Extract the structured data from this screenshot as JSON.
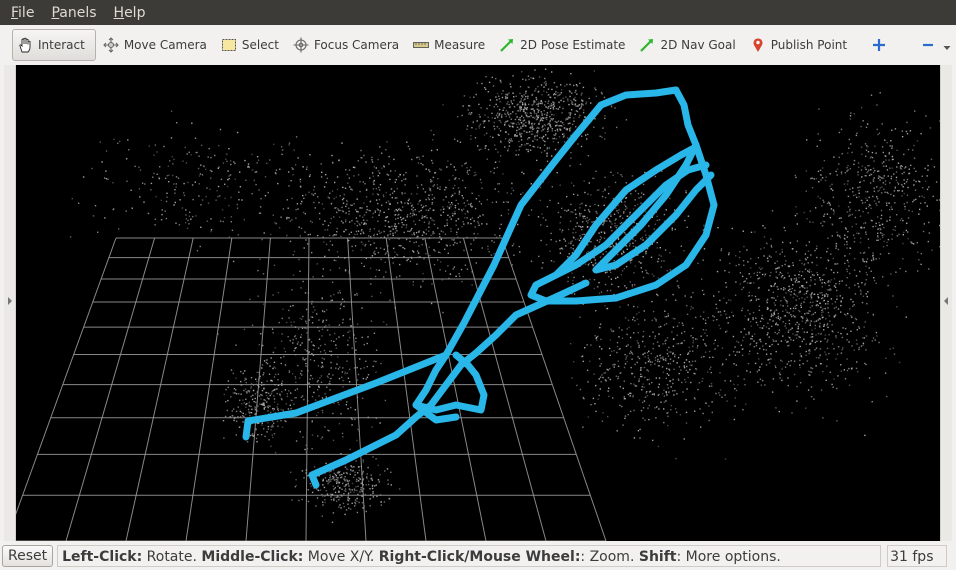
{
  "menubar": {
    "items": [
      {
        "mnemonic": "F",
        "rest": "ile"
      },
      {
        "mnemonic": "P",
        "rest": "anels"
      },
      {
        "mnemonic": "H",
        "rest": "elp"
      }
    ]
  },
  "toolbar": {
    "tools": [
      {
        "label": "Interact",
        "icon": "hand-icon",
        "active": true
      },
      {
        "label": "Move Camera",
        "icon": "move-camera-icon"
      },
      {
        "label": "Select",
        "icon": "select-icon"
      },
      {
        "label": "Focus Camera",
        "icon": "focus-camera-icon"
      },
      {
        "label": "Measure",
        "icon": "ruler-icon"
      },
      {
        "label": "2D Pose Estimate",
        "icon": "green-arrow-icon"
      },
      {
        "label": "2D Nav Goal",
        "icon": "green-arrow-icon"
      },
      {
        "label": "Publish Point",
        "icon": "map-pin-icon"
      }
    ],
    "add_icon": "plus-icon",
    "remove_icon": "minus-icon",
    "dropdown_icon": "chevron-down-icon"
  },
  "viewport": {
    "background": "#000000",
    "grid_color": "#a0a0a0",
    "point_color": "#b4b4b4",
    "path_color": "#29b6e8"
  },
  "statusbar": {
    "reset_label": "Reset",
    "help": {
      "left_click_key": "Left-Click:",
      "left_click_action": " Rotate. ",
      "middle_click_key": "Middle-Click:",
      "middle_click_action": " Move X/Y. ",
      "right_click_key": "Right-Click/Mouse Wheel:",
      "right_click_action": ": Zoom. ",
      "shift_key": "Shift",
      "shift_action": ": More options."
    },
    "fps": "31 fps"
  }
}
